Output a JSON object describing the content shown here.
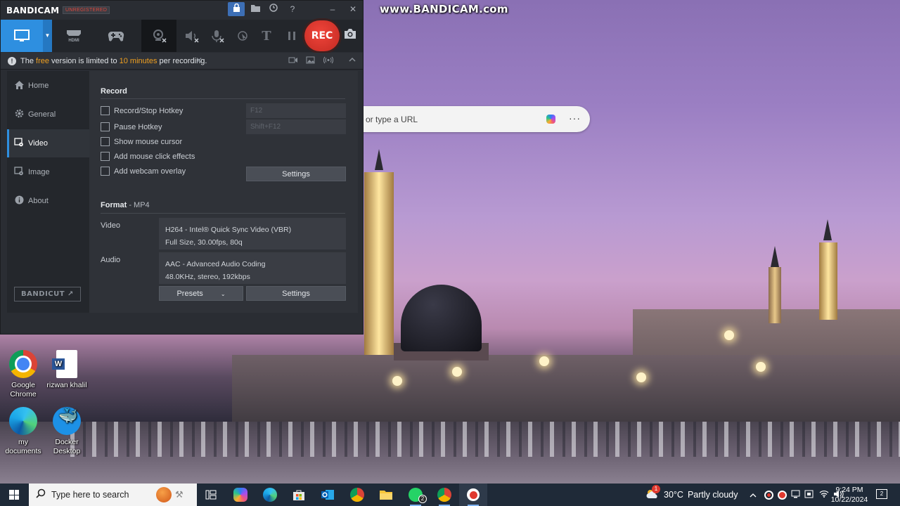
{
  "watermark": "www.BANDICAM.com",
  "browser": {
    "address_placeholder": "or type a URL",
    "more_label": "···"
  },
  "bandicam": {
    "logo": "BANDICAM",
    "unregistered_badge": "UNREGISTERED",
    "title_buttons": [
      "lock",
      "folder",
      "history",
      "help",
      "minimize",
      "close"
    ],
    "modes": [
      "screen-mode",
      "hdmi-mode",
      "game-mode"
    ],
    "hdmi_label": "HDMI",
    "rec_label": "REC",
    "notice": {
      "pre": "The ",
      "free": "free",
      "mid": " version is limited to ",
      "limit": "10 minutes",
      "post": " per recording."
    },
    "sidebar": {
      "items": [
        {
          "label": "Home",
          "icon": "home-icon"
        },
        {
          "label": "General",
          "icon": "gear-icon"
        },
        {
          "label": "Video",
          "icon": "video-settings-icon",
          "active": true
        },
        {
          "label": "Image",
          "icon": "image-icon"
        },
        {
          "label": "About",
          "icon": "info-icon"
        }
      ],
      "bandicut": "BANDICUT ↗"
    },
    "record": {
      "title": "Record",
      "options": [
        {
          "label": "Record/Stop Hotkey",
          "checked": false
        },
        {
          "label": "Pause Hotkey",
          "checked": false
        },
        {
          "label": "Show mouse cursor",
          "checked": false
        },
        {
          "label": "Add mouse click effects",
          "checked": false
        },
        {
          "label": "Add webcam overlay",
          "checked": false
        }
      ],
      "hotkey_record": "F12",
      "hotkey_pause": "Shift+F12",
      "settings_label": "Settings"
    },
    "format": {
      "title": "Format",
      "container": " - MP4",
      "video_label": "Video",
      "video_line1": "H264 - Intel® Quick Sync Video (VBR)",
      "video_line2": "Full Size, 30.00fps, 80q",
      "audio_label": "Audio",
      "audio_line1": "AAC - Advanced Audio Coding",
      "audio_line2": "48.0KHz, stereo, 192kbps",
      "presets_label": "Presets",
      "settings_label": "Settings"
    },
    "colors": {
      "accent": "#2e8fe0",
      "rec": "#e0392f",
      "highlight": "#f0a020"
    }
  },
  "desktop_icons": [
    {
      "label": "Google Chrome",
      "icon": "chrome-icon"
    },
    {
      "label": "rizwan khalil",
      "icon": "word-doc-icon"
    },
    {
      "label": "my documents",
      "icon": "edge-icon"
    },
    {
      "label": "Docker Desktop",
      "icon": "docker-icon"
    }
  ],
  "taskbar": {
    "search_placeholder": "Type here to search",
    "apps": [
      "task-view",
      "copilot",
      "edge",
      "store",
      "outlook",
      "chrome",
      "file-explorer",
      "whatsapp",
      "chrome-profile",
      "bandicam"
    ],
    "whatsapp_badge": "2",
    "weather_temp": "30°C",
    "weather_desc": "Partly cloudy",
    "weather_badge": "1",
    "time": "9:24 PM",
    "date": "10/22/2024",
    "notification_count": "2"
  }
}
